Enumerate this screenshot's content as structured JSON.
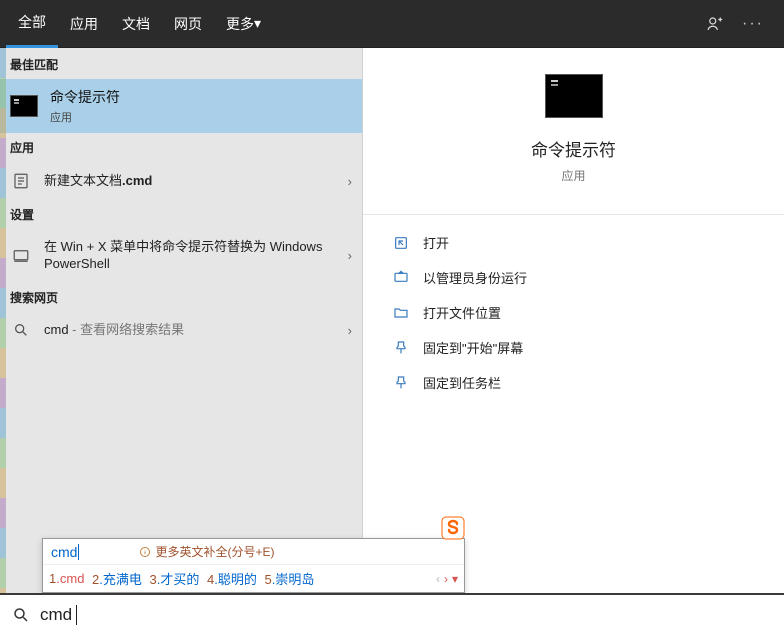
{
  "tabs": {
    "items": [
      "全部",
      "应用",
      "文档",
      "网页",
      "更多"
    ],
    "more_suffix": " ▾",
    "active_index": 0
  },
  "sections": {
    "best_match": "最佳匹配",
    "apps": "应用",
    "settings": "设置",
    "web": "搜索网页"
  },
  "best": {
    "name": "命令提示符",
    "sub": "应用"
  },
  "app_row": {
    "prefix": "新建文本文档",
    "suffix": ".cmd"
  },
  "setting_row": "在 Win + X 菜单中将命令提示符替换为 Windows PowerShell",
  "web_row": {
    "query": "cmd",
    "suffix": " - 查看网络搜索结果"
  },
  "preview": {
    "title": "命令提示符",
    "sub": "应用"
  },
  "actions": [
    "打开",
    "以管理员身份运行",
    "打开文件位置",
    "固定到\"开始\"屏幕",
    "固定到任务栏"
  ],
  "ime": {
    "composition": "cmd",
    "hint": "更多英文补全(分号+E)",
    "candidates": [
      {
        "n": "1",
        "t": "cmd"
      },
      {
        "n": "2",
        "t": "充满电"
      },
      {
        "n": "3",
        "t": "才买的"
      },
      {
        "n": "4",
        "t": "聪明的"
      },
      {
        "n": "5",
        "t": "崇明岛"
      }
    ]
  },
  "search": {
    "query": "cmd"
  },
  "colors": {
    "accent": "#3393df",
    "selection": "#a9d0e8"
  }
}
